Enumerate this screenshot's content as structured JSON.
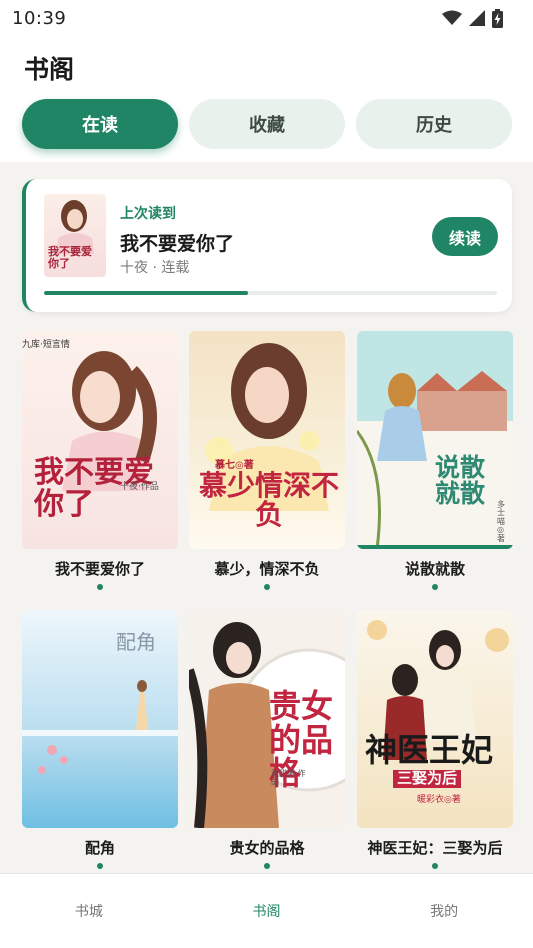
{
  "status": {
    "time": "10:39",
    "icons": [
      "wifi-icon",
      "signal-icon",
      "battery-charging-icon"
    ]
  },
  "header": {
    "title": "书阁"
  },
  "tabs": [
    {
      "label": "在读",
      "active": true
    },
    {
      "label": "收藏",
      "active": false
    },
    {
      "label": "历史",
      "active": false
    }
  ],
  "continue_reading": {
    "label": "上次读到",
    "title": "我不要爱你了",
    "meta": "十夜 · 连载",
    "button": "续读",
    "progress": 0.45,
    "cover_text": "我不要爱你了"
  },
  "books": [
    {
      "title": "我不要爱你了",
      "cover_text": "我不要爱你了",
      "cover_author": "十夜·作品",
      "cover_publisher": "九库·短言情"
    },
    {
      "title": "慕少，情深不负",
      "cover_text": "慕少情深不负",
      "cover_author": "慕七◎著"
    },
    {
      "title": "说散就散",
      "cover_text": "说散就散",
      "cover_author": "多士喵◎著"
    },
    {
      "title": "配角",
      "cover_text": "配角"
    },
    {
      "title": "贵女的品格",
      "cover_text": "贵女的品格",
      "cover_author": "流甜粥·作品"
    },
    {
      "title": "神医王妃：三娶为后",
      "cover_text": "神医王妃",
      "cover_subtext": "三娶为后",
      "cover_author": "暖彩衣◎著"
    }
  ],
  "bottom_nav": [
    {
      "label": "书城",
      "active": false
    },
    {
      "label": "书阁",
      "active": true
    },
    {
      "label": "我的",
      "active": false
    }
  ],
  "colors": {
    "accent": "#1f8564",
    "tab_inactive": "#e8f1ec",
    "page_bg": "#f4f3ef"
  }
}
